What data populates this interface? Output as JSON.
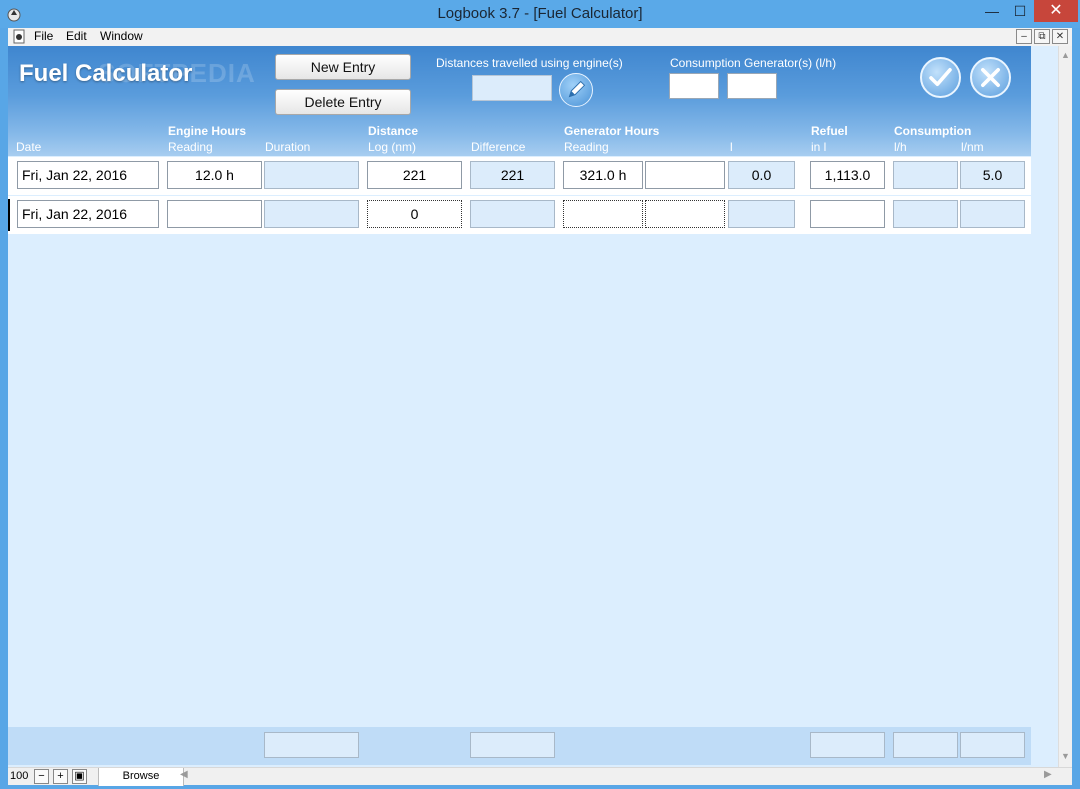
{
  "window": {
    "title": "Logbook 3.7 - [Fuel Calculator]"
  },
  "menu": {
    "items": [
      "File",
      "Edit",
      "Window"
    ]
  },
  "header": {
    "title": "Fuel Calculator",
    "watermark": "SOFTPEDIA",
    "new_entry_label": "New Entry",
    "delete_entry_label": "Delete Entry",
    "distances_label": "Distances travelled using engine(s)",
    "consumption_generator_label": "Consumption Generator(s) (l/h)"
  },
  "columns": {
    "date": "Date",
    "engine_hours": "Engine Hours",
    "reading": "Reading",
    "duration": "Duration",
    "distance": "Distance",
    "log_nm": "Log (nm)",
    "difference": "Difference",
    "generator_hours": "Generator Hours",
    "gen_reading": "Reading",
    "l": "l",
    "refuel": "Refuel",
    "in_l": "in l",
    "consumption": "Consumption",
    "lh": "l/h",
    "lnm": "l/nm"
  },
  "rows": [
    {
      "date": "Fri, Jan 22, 2016",
      "engine_reading": "12.0 h",
      "duration": "",
      "log": "221",
      "difference": "221",
      "gen_reading": "321.0 h",
      "gen_duration": "",
      "l": "0.0",
      "refuel": "1,113.0",
      "lh": "",
      "lnm": "5.0"
    },
    {
      "date": "Fri, Jan 22, 2016",
      "engine_reading": "",
      "duration": "",
      "log": "0",
      "difference": "",
      "gen_reading": "",
      "gen_duration": "",
      "l": "",
      "refuel": "",
      "lh": "",
      "lnm": ""
    }
  ],
  "status": {
    "zoom": "100",
    "mode": "Browse"
  },
  "colors": {
    "titlebar": "#5aa9e8",
    "header": "#4a8fd4",
    "content": "#dceefe",
    "close": "#c7463b"
  }
}
